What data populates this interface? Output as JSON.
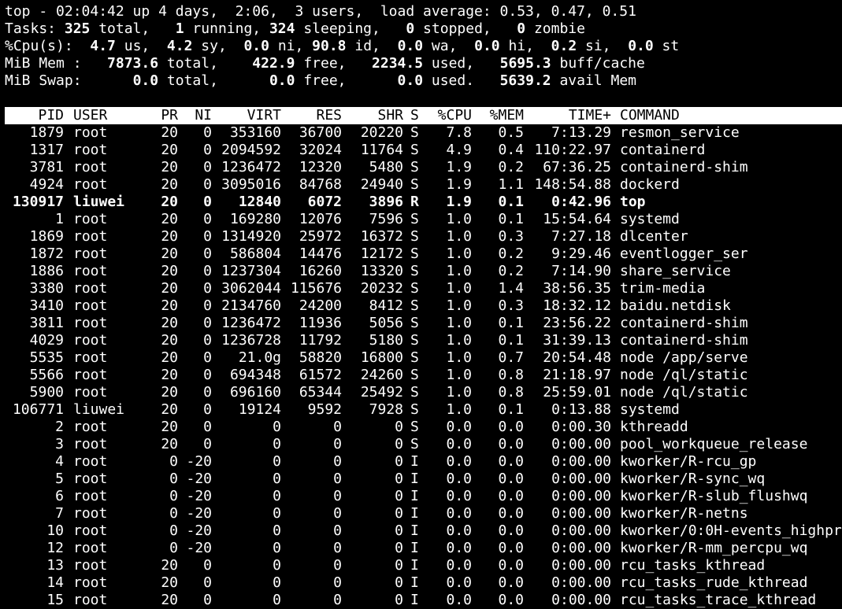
{
  "summary": {
    "line1": "top - 02:04:42 up 4 days,  2:06,  3 users,  load average: 0.53, 0.47, 0.51",
    "tasks": [
      {
        "t": "Tasks: ",
        "b": false
      },
      {
        "t": "325",
        "b": true
      },
      {
        "t": " total,   ",
        "b": false
      },
      {
        "t": "1",
        "b": true
      },
      {
        "t": " running, ",
        "b": false
      },
      {
        "t": "324",
        "b": true
      },
      {
        "t": " sleeping,   ",
        "b": false
      },
      {
        "t": "0",
        "b": true
      },
      {
        "t": " stopped,   ",
        "b": false
      },
      {
        "t": "0",
        "b": true
      },
      {
        "t": " zombie",
        "b": false
      }
    ],
    "cpu": [
      {
        "t": "%Cpu(s):  ",
        "b": false
      },
      {
        "t": "4.7",
        "b": true
      },
      {
        "t": " us,  ",
        "b": false
      },
      {
        "t": "4.2",
        "b": true
      },
      {
        "t": " sy,  ",
        "b": false
      },
      {
        "t": "0.0",
        "b": true
      },
      {
        "t": " ni, ",
        "b": false
      },
      {
        "t": "90.8",
        "b": true
      },
      {
        "t": " id,  ",
        "b": false
      },
      {
        "t": "0.0",
        "b": true
      },
      {
        "t": " wa,  ",
        "b": false
      },
      {
        "t": "0.0",
        "b": true
      },
      {
        "t": " hi,  ",
        "b": false
      },
      {
        "t": "0.2",
        "b": true
      },
      {
        "t": " si,  ",
        "b": false
      },
      {
        "t": "0.0",
        "b": true
      },
      {
        "t": " st",
        "b": false
      }
    ],
    "mem": [
      {
        "t": "MiB Mem :   ",
        "b": false
      },
      {
        "t": "7873.6",
        "b": true
      },
      {
        "t": " total,    ",
        "b": false
      },
      {
        "t": "422.9",
        "b": true
      },
      {
        "t": " free,   ",
        "b": false
      },
      {
        "t": "2234.5",
        "b": true
      },
      {
        "t": " used,   ",
        "b": false
      },
      {
        "t": "5695.3",
        "b": true
      },
      {
        "t": " buff/cache",
        "b": false
      }
    ],
    "swap": [
      {
        "t": "MiB Swap:      ",
        "b": false
      },
      {
        "t": "0.0",
        "b": true
      },
      {
        "t": " total,      ",
        "b": false
      },
      {
        "t": "0.0",
        "b": true
      },
      {
        "t": " free,      ",
        "b": false
      },
      {
        "t": "0.0",
        "b": true
      },
      {
        "t": " used.   ",
        "b": false
      },
      {
        "t": "5639.2",
        "b": true
      },
      {
        "t": " avail Mem",
        "b": false
      }
    ]
  },
  "columns": [
    "PID",
    "USER",
    "PR",
    "NI",
    "VIRT",
    "RES",
    "SHR",
    "S",
    "%CPU",
    "%MEM",
    "TIME+",
    "COMMAND"
  ],
  "processes": [
    {
      "pid": "1879",
      "user": "root",
      "pr": "20",
      "ni": "0",
      "virt": "353160",
      "res": "36700",
      "shr": "20220",
      "s": "S",
      "cpu": "7.8",
      "mem": "0.5",
      "time": "7:13.29",
      "cmd": "resmon_service",
      "bold": false
    },
    {
      "pid": "1317",
      "user": "root",
      "pr": "20",
      "ni": "0",
      "virt": "2094592",
      "res": "32024",
      "shr": "11764",
      "s": "S",
      "cpu": "4.9",
      "mem": "0.4",
      "time": "110:22.97",
      "cmd": "containerd",
      "bold": false
    },
    {
      "pid": "3781",
      "user": "root",
      "pr": "20",
      "ni": "0",
      "virt": "1236472",
      "res": "12320",
      "shr": "5480",
      "s": "S",
      "cpu": "1.9",
      "mem": "0.2",
      "time": "67:36.25",
      "cmd": "containerd-shim",
      "bold": false
    },
    {
      "pid": "4924",
      "user": "root",
      "pr": "20",
      "ni": "0",
      "virt": "3095016",
      "res": "84768",
      "shr": "24940",
      "s": "S",
      "cpu": "1.9",
      "mem": "1.1",
      "time": "148:54.88",
      "cmd": "dockerd",
      "bold": false
    },
    {
      "pid": "130917",
      "user": "liuwei",
      "pr": "20",
      "ni": "0",
      "virt": "12840",
      "res": "6072",
      "shr": "3896",
      "s": "R",
      "cpu": "1.9",
      "mem": "0.1",
      "time": "0:42.96",
      "cmd": "top",
      "bold": true
    },
    {
      "pid": "1",
      "user": "root",
      "pr": "20",
      "ni": "0",
      "virt": "169280",
      "res": "12076",
      "shr": "7596",
      "s": "S",
      "cpu": "1.0",
      "mem": "0.1",
      "time": "15:54.64",
      "cmd": "systemd",
      "bold": false
    },
    {
      "pid": "1869",
      "user": "root",
      "pr": "20",
      "ni": "0",
      "virt": "1314920",
      "res": "25972",
      "shr": "16372",
      "s": "S",
      "cpu": "1.0",
      "mem": "0.3",
      "time": "7:27.18",
      "cmd": "dlcenter",
      "bold": false
    },
    {
      "pid": "1872",
      "user": "root",
      "pr": "20",
      "ni": "0",
      "virt": "586804",
      "res": "14476",
      "shr": "12172",
      "s": "S",
      "cpu": "1.0",
      "mem": "0.2",
      "time": "9:29.46",
      "cmd": "eventlogger_ser",
      "bold": false
    },
    {
      "pid": "1886",
      "user": "root",
      "pr": "20",
      "ni": "0",
      "virt": "1237304",
      "res": "16260",
      "shr": "13320",
      "s": "S",
      "cpu": "1.0",
      "mem": "0.2",
      "time": "7:14.90",
      "cmd": "share_service",
      "bold": false
    },
    {
      "pid": "3380",
      "user": "root",
      "pr": "20",
      "ni": "0",
      "virt": "3062044",
      "res": "115676",
      "shr": "20232",
      "s": "S",
      "cpu": "1.0",
      "mem": "1.4",
      "time": "38:56.35",
      "cmd": "trim-media",
      "bold": false
    },
    {
      "pid": "3410",
      "user": "root",
      "pr": "20",
      "ni": "0",
      "virt": "2134760",
      "res": "24200",
      "shr": "8412",
      "s": "S",
      "cpu": "1.0",
      "mem": "0.3",
      "time": "18:32.12",
      "cmd": "baidu.netdisk",
      "bold": false
    },
    {
      "pid": "3811",
      "user": "root",
      "pr": "20",
      "ni": "0",
      "virt": "1236472",
      "res": "11936",
      "shr": "5056",
      "s": "S",
      "cpu": "1.0",
      "mem": "0.1",
      "time": "23:56.22",
      "cmd": "containerd-shim",
      "bold": false
    },
    {
      "pid": "4029",
      "user": "root",
      "pr": "20",
      "ni": "0",
      "virt": "1236728",
      "res": "11792",
      "shr": "5180",
      "s": "S",
      "cpu": "1.0",
      "mem": "0.1",
      "time": "31:39.13",
      "cmd": "containerd-shim",
      "bold": false
    },
    {
      "pid": "5535",
      "user": "root",
      "pr": "20",
      "ni": "0",
      "virt": "21.0g",
      "res": "58820",
      "shr": "16800",
      "s": "S",
      "cpu": "1.0",
      "mem": "0.7",
      "time": "20:54.48",
      "cmd": "node /app/serve",
      "bold": false
    },
    {
      "pid": "5566",
      "user": "root",
      "pr": "20",
      "ni": "0",
      "virt": "694348",
      "res": "61572",
      "shr": "24260",
      "s": "S",
      "cpu": "1.0",
      "mem": "0.8",
      "time": "21:18.97",
      "cmd": "node /ql/static",
      "bold": false
    },
    {
      "pid": "5900",
      "user": "root",
      "pr": "20",
      "ni": "0",
      "virt": "696160",
      "res": "65344",
      "shr": "25492",
      "s": "S",
      "cpu": "1.0",
      "mem": "0.8",
      "time": "25:59.01",
      "cmd": "node /ql/static",
      "bold": false
    },
    {
      "pid": "106771",
      "user": "liuwei",
      "pr": "20",
      "ni": "0",
      "virt": "19124",
      "res": "9592",
      "shr": "7928",
      "s": "S",
      "cpu": "1.0",
      "mem": "0.1",
      "time": "0:13.88",
      "cmd": "systemd",
      "bold": false
    },
    {
      "pid": "2",
      "user": "root",
      "pr": "20",
      "ni": "0",
      "virt": "0",
      "res": "0",
      "shr": "0",
      "s": "S",
      "cpu": "0.0",
      "mem": "0.0",
      "time": "0:00.30",
      "cmd": "kthreadd",
      "bold": false
    },
    {
      "pid": "3",
      "user": "root",
      "pr": "20",
      "ni": "0",
      "virt": "0",
      "res": "0",
      "shr": "0",
      "s": "S",
      "cpu": "0.0",
      "mem": "0.0",
      "time": "0:00.00",
      "cmd": "pool_workqueue_release",
      "bold": false
    },
    {
      "pid": "4",
      "user": "root",
      "pr": "0",
      "ni": "-20",
      "virt": "0",
      "res": "0",
      "shr": "0",
      "s": "I",
      "cpu": "0.0",
      "mem": "0.0",
      "time": "0:00.00",
      "cmd": "kworker/R-rcu_gp",
      "bold": false
    },
    {
      "pid": "5",
      "user": "root",
      "pr": "0",
      "ni": "-20",
      "virt": "0",
      "res": "0",
      "shr": "0",
      "s": "I",
      "cpu": "0.0",
      "mem": "0.0",
      "time": "0:00.00",
      "cmd": "kworker/R-sync_wq",
      "bold": false
    },
    {
      "pid": "6",
      "user": "root",
      "pr": "0",
      "ni": "-20",
      "virt": "0",
      "res": "0",
      "shr": "0",
      "s": "I",
      "cpu": "0.0",
      "mem": "0.0",
      "time": "0:00.00",
      "cmd": "kworker/R-slub_flushwq",
      "bold": false
    },
    {
      "pid": "7",
      "user": "root",
      "pr": "0",
      "ni": "-20",
      "virt": "0",
      "res": "0",
      "shr": "0",
      "s": "I",
      "cpu": "0.0",
      "mem": "0.0",
      "time": "0:00.00",
      "cmd": "kworker/R-netns",
      "bold": false
    },
    {
      "pid": "10",
      "user": "root",
      "pr": "0",
      "ni": "-20",
      "virt": "0",
      "res": "0",
      "shr": "0",
      "s": "I",
      "cpu": "0.0",
      "mem": "0.0",
      "time": "0:00.00",
      "cmd": "kworker/0:0H-events_highpr",
      "bold": false
    },
    {
      "pid": "12",
      "user": "root",
      "pr": "0",
      "ni": "-20",
      "virt": "0",
      "res": "0",
      "shr": "0",
      "s": "I",
      "cpu": "0.0",
      "mem": "0.0",
      "time": "0:00.00",
      "cmd": "kworker/R-mm_percpu_wq",
      "bold": false
    },
    {
      "pid": "13",
      "user": "root",
      "pr": "20",
      "ni": "0",
      "virt": "0",
      "res": "0",
      "shr": "0",
      "s": "I",
      "cpu": "0.0",
      "mem": "0.0",
      "time": "0:00.00",
      "cmd": "rcu_tasks_kthread",
      "bold": false
    },
    {
      "pid": "14",
      "user": "root",
      "pr": "20",
      "ni": "0",
      "virt": "0",
      "res": "0",
      "shr": "0",
      "s": "I",
      "cpu": "0.0",
      "mem": "0.0",
      "time": "0:00.00",
      "cmd": "rcu_tasks_rude_kthread",
      "bold": false
    },
    {
      "pid": "15",
      "user": "root",
      "pr": "20",
      "ni": "0",
      "virt": "0",
      "res": "0",
      "shr": "0",
      "s": "I",
      "cpu": "0.0",
      "mem": "0.0",
      "time": "0:00.00",
      "cmd": "rcu_tasks_trace_kthread",
      "bold": false
    }
  ]
}
